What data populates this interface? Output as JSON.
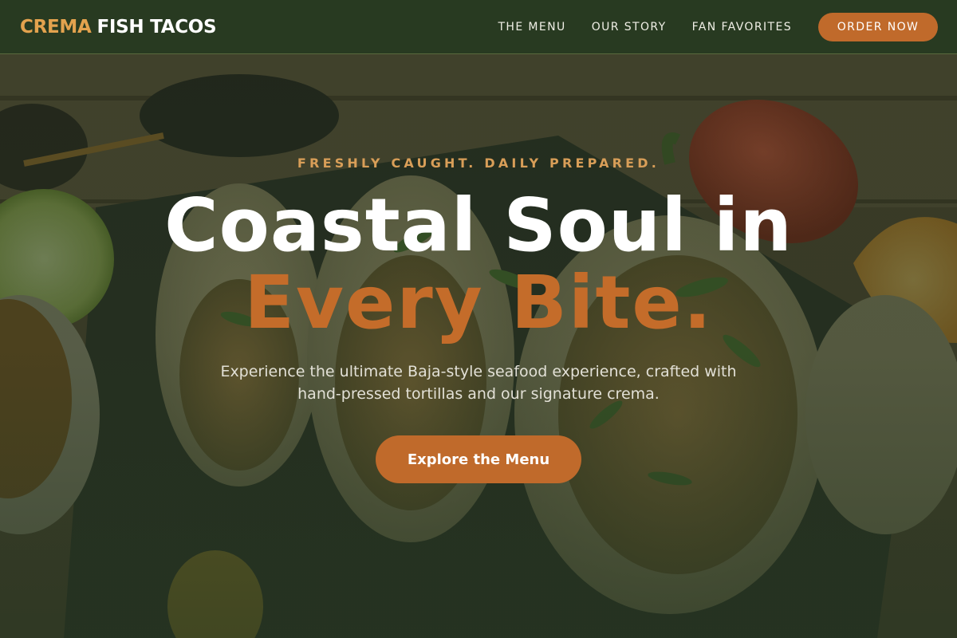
{
  "brand": {
    "accent_word": "CREMA",
    "main_words": "FISH TACOS",
    "accent_color": "#e3a24e"
  },
  "nav": {
    "links": [
      {
        "label": "THE MENU"
      },
      {
        "label": "OUR STORY"
      },
      {
        "label": "FAN FAVORITES"
      }
    ],
    "order_label": "ORDER NOW"
  },
  "hero": {
    "tagline": "FRESHLY CAUGHT. DAILY PREPARED.",
    "headline_line1": "Coastal Soul in",
    "headline_line2": "Every Bite.",
    "subtext": "Experience the ultimate Baja-style seafood experience, crafted with hand-pressed tortillas and our signature crema.",
    "cta_label": "Explore the Menu"
  },
  "colors": {
    "nav_background": "#283a21",
    "primary_orange": "#c06a2b",
    "headline_orange": "#c46c2a",
    "tagline_gold": "#d89e58"
  }
}
